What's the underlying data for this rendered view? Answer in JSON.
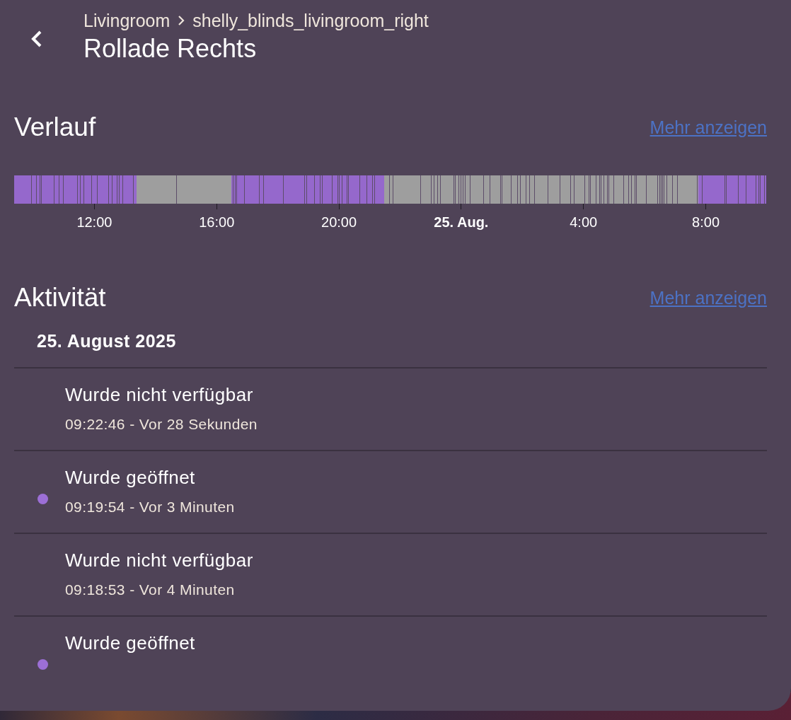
{
  "header": {
    "breadcrumb": [
      "Livingroom",
      "shelly_blinds_livingroom_right"
    ],
    "title": "Rollade Rechts"
  },
  "history": {
    "title": "Verlauf",
    "more_link": "Mehr anzeigen",
    "ticks": [
      {
        "label": "12:00",
        "bold": false
      },
      {
        "label": "16:00",
        "bold": false
      },
      {
        "label": "20:00",
        "bold": false
      },
      {
        "label": "25. Aug.",
        "bold": true
      },
      {
        "label": "4:00",
        "bold": false
      },
      {
        "label": "8:00",
        "bold": false
      }
    ]
  },
  "activity": {
    "title": "Aktivität",
    "more_link": "Mehr anzeigen",
    "date": "25. August 2025",
    "entries": [
      {
        "message": "Wurde nicht verfügbar",
        "time": "09:22:46 - Vor 28 Sekunden"
      },
      {
        "message": "Wurde geöffnet",
        "time": "09:19:54 - Vor 3 Minuten",
        "color": "#9c6fd6"
      },
      {
        "message": "Wurde nicht verfügbar",
        "time": "09:18:53 - Vor 4 Minuten"
      },
      {
        "message": "Wurde geöffnet",
        "color": "#9c6fd6"
      }
    ]
  }
}
